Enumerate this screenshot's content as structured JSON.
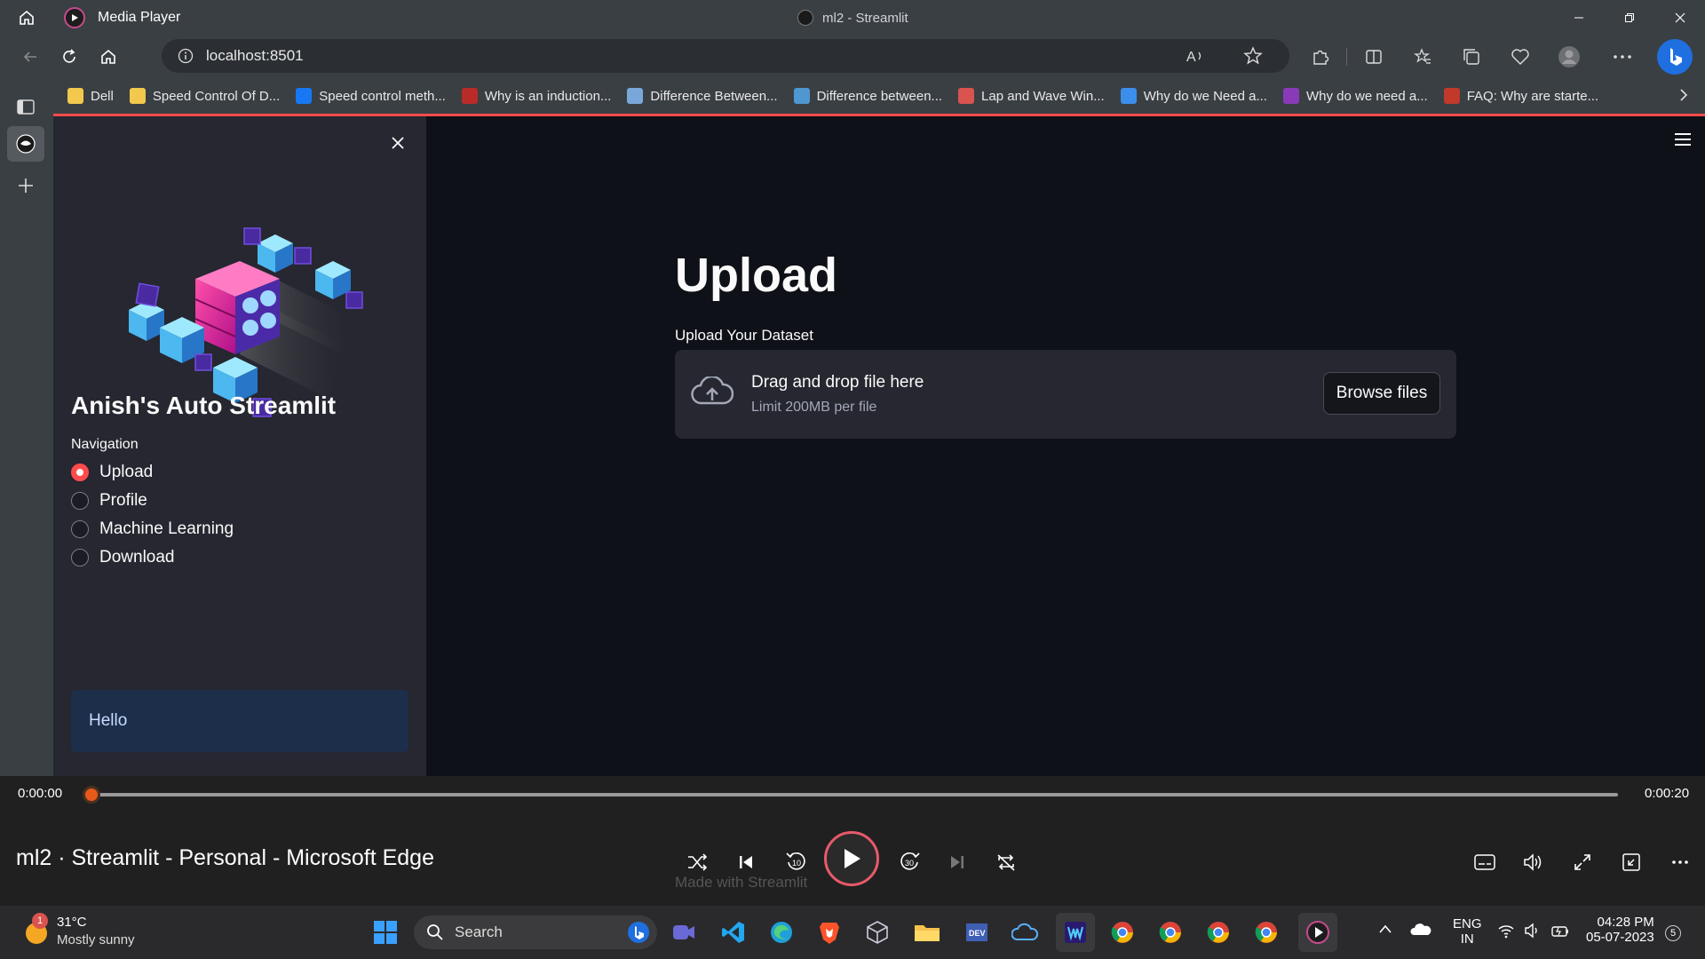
{
  "window": {
    "app_title": "Media Player",
    "center_title": "ml2 - Streamlit"
  },
  "browser": {
    "url": "localhost:8501",
    "bookmarks": [
      {
        "label": "Dell",
        "icon": "folder-icon",
        "color": "#f2c94c"
      },
      {
        "label": "Speed Control Of D...",
        "icon": "bulb-icon",
        "color": "#f2c94c"
      },
      {
        "label": "Speed control meth...",
        "icon": "info-icon",
        "color": "#1877f2"
      },
      {
        "label": "Why is an induction...",
        "icon": "quora-icon",
        "color": "#b92b27"
      },
      {
        "label": "Difference Between...",
        "icon": "site-icon",
        "color": "#7aa7d9"
      },
      {
        "label": "Difference between...",
        "icon": "wordpress-icon",
        "color": "#4f97d1"
      },
      {
        "label": "Lap and Wave Win...",
        "icon": "site-icon",
        "color": "#d9534f"
      },
      {
        "label": "Why do we Need a...",
        "icon": "check-icon",
        "color": "#3b8eea"
      },
      {
        "label": "Why do we need a...",
        "icon": "site-icon",
        "color": "#8a3ab9"
      },
      {
        "label": "FAQ: Why are starte...",
        "icon": "site-icon",
        "color": "#c0392b"
      }
    ]
  },
  "sidebar": {
    "app_name": "Anish's Auto Streamlit",
    "nav_label": "Navigation",
    "options": [
      "Upload",
      "Profile",
      "Machine Learning",
      "Download"
    ],
    "selected_index": 0,
    "info_text": "Hello"
  },
  "main": {
    "title": "Upload",
    "uploader_label": "Upload Your Dataset",
    "drop_text": "Drag and drop file here",
    "limit_text": "Limit 200MB per file",
    "browse_label": "Browse files",
    "footer_text": "Made with Streamlit"
  },
  "player": {
    "time_current": "0:00:00",
    "time_total": "0:00:20",
    "progress": 0.0,
    "media_title": "ml2 · Streamlit - Personal - Microsoft Edge",
    "accent": "#e85a1a"
  },
  "taskbar": {
    "temperature": "31°C",
    "weather": "Mostly sunny",
    "weather_badge": "1",
    "search_placeholder": "Search",
    "lang_line1": "ENG",
    "lang_line2": "IN",
    "time": "04:28 PM",
    "date": "05-07-2023",
    "notification_count": "5"
  }
}
